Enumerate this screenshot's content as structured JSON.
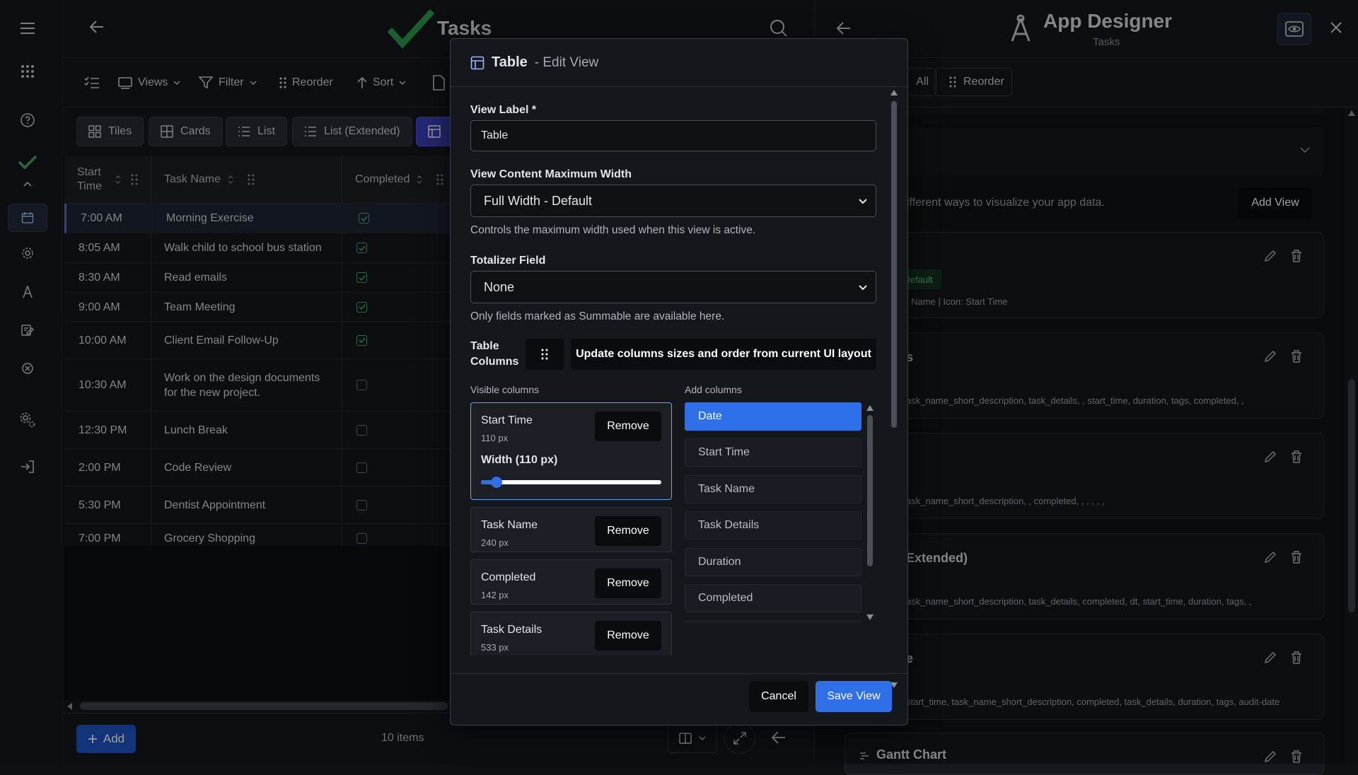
{
  "app": {
    "title": "Tasks",
    "toolbar": {
      "views": "Views",
      "filter": "Filter",
      "reorder": "Reorder",
      "sort": "Sort"
    },
    "view_tabs": [
      {
        "label": "Tiles",
        "icon": "tiles-icon"
      },
      {
        "label": "Cards",
        "icon": "cards-icon"
      },
      {
        "label": "List",
        "icon": "list-icon"
      },
      {
        "label": "List (Extended)",
        "icon": "list-extended-icon"
      },
      {
        "label": "",
        "icon": "table-icon",
        "active": true
      }
    ],
    "table": {
      "columns": [
        "Start Time",
        "Task Name",
        "Completed"
      ],
      "rows": [
        {
          "start": "7:00 AM",
          "task": "Morning Exercise",
          "done": true
        },
        {
          "start": "8:05 AM",
          "task": "Walk child to school bus station",
          "done": true
        },
        {
          "start": "8:30 AM",
          "task": "Read emails",
          "done": true
        },
        {
          "start": "9:00 AM",
          "task": "Team Meeting",
          "done": true
        },
        {
          "start": "10:00 AM",
          "task": "Client Email Follow-Up",
          "done": true
        },
        {
          "start": "10:30 AM",
          "task": "Work on the design documents for the new project.",
          "done": false
        },
        {
          "start": "12:30 PM",
          "task": "Lunch Break",
          "done": false
        },
        {
          "start": "2:00 PM",
          "task": "Code Review",
          "done": false
        },
        {
          "start": "5:30 PM",
          "task": "Dentist Appointment",
          "done": false
        },
        {
          "start": "7:00 PM",
          "task": "Grocery Shopping",
          "done": false
        }
      ]
    },
    "footer": {
      "add_label": "Add",
      "count": "10 items"
    }
  },
  "designer": {
    "title": "App Designer",
    "subtitle": "Tasks",
    "all_label": "All",
    "reorder_label": "Reorder",
    "views_desc": "ifferent ways to visualize your app data.",
    "add_view_label": "Add View",
    "cards": [
      {
        "title": "",
        "badge": "Default",
        "meta": ": Name | Icon: Start Time"
      },
      {
        "title": "s",
        "meta": "ask_name_short_description, task_details, , start_time, duration, tags, completed, ,"
      },
      {
        "title": "",
        "meta": "ask_name_short_description, , completed, , , , , ,"
      },
      {
        "title": "Extended)",
        "meta": "ask_name_short_description, task_details, completed, dt, start_time, duration, tags, ,"
      },
      {
        "title": "e",
        "meta": "start_time, task_name_short_description, completed, task_details, duration, tags, audit-date"
      },
      {
        "title": "Gantt Chart",
        "meta": ""
      }
    ]
  },
  "modal": {
    "title": "Table",
    "subtitle": "- Edit View",
    "view_label_label": "View Label *",
    "view_label_value": "Table",
    "max_width_label": "View Content Maximum Width",
    "max_width_value": "Full Width - Default",
    "max_width_hint": "Controls the maximum width used when this view is active.",
    "totalizer_label": "Totalizer Field",
    "totalizer_value": "None",
    "totalizer_hint": "Only fields marked as Summable are available here.",
    "table_columns_label": "Table Columns",
    "update_columns_label": "Update columns sizes and order from current UI layout",
    "visible_columns_label": "Visible columns",
    "add_columns_label": "Add columns",
    "remove_label": "Remove",
    "visible_columns": [
      {
        "name": "Start Time",
        "px": "110 px",
        "width_label": "Width (110 px)",
        "width_value": 0.06
      },
      {
        "name": "Task Name",
        "px": "240 px"
      },
      {
        "name": "Completed",
        "px": "142 px"
      },
      {
        "name": "Task Details",
        "px": "533 px"
      }
    ],
    "add_columns": [
      "Date",
      "Start Time",
      "Task Name",
      "Task Details",
      "Duration",
      "Completed"
    ],
    "cancel_label": "Cancel",
    "save_label": "Save View"
  },
  "colors": {
    "accent": "#2f6fe8",
    "check": "#4ca667",
    "active_tab": "#3b3fb8"
  }
}
